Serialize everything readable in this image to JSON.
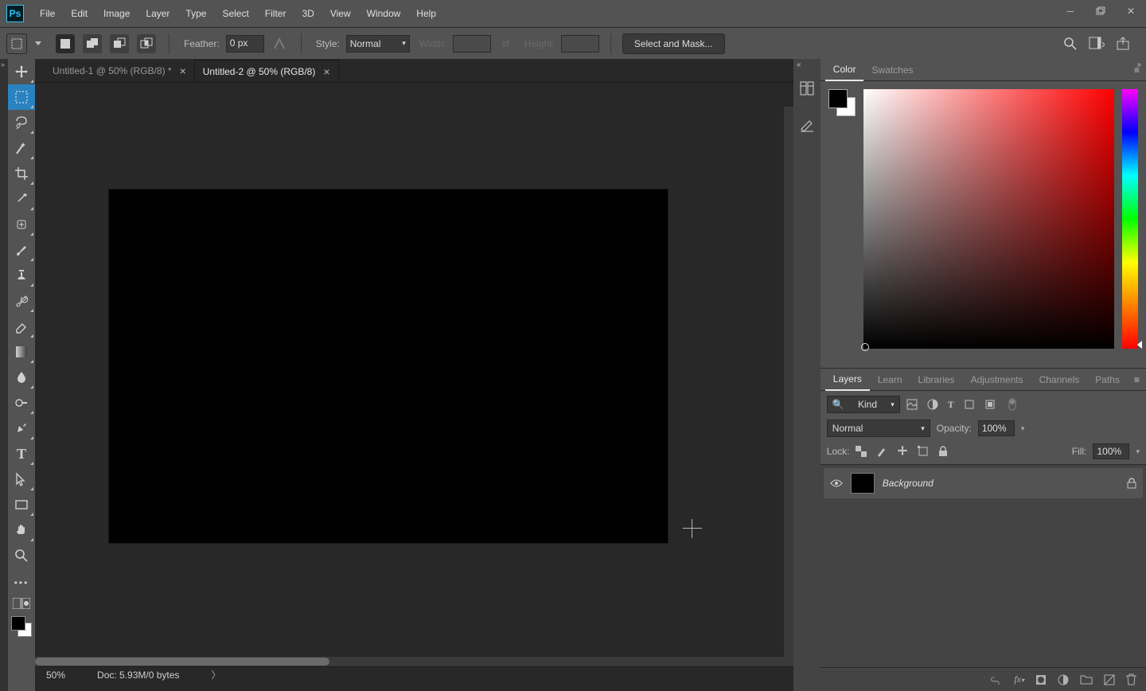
{
  "menu": {
    "items": [
      "File",
      "Edit",
      "Image",
      "Layer",
      "Type",
      "Select",
      "Filter",
      "3D",
      "View",
      "Window",
      "Help"
    ]
  },
  "options": {
    "feather_label": "Feather:",
    "feather_value": "0 px",
    "style_label": "Style:",
    "style_value": "Normal",
    "width_label": "Width:",
    "height_label": "Height:",
    "select_mask": "Select and Mask..."
  },
  "tabs": [
    {
      "title": "Untitled-1 @ 50% (RGB/8) *",
      "active": false
    },
    {
      "title": "Untitled-2 @ 50% (RGB/8)",
      "active": true
    }
  ],
  "status": {
    "zoom": "50%",
    "doc": "Doc: 5.93M/0 bytes"
  },
  "panelTabs": {
    "color": [
      "Color",
      "Swatches"
    ],
    "layers": [
      "Layers",
      "Learn",
      "Libraries",
      "Adjustments",
      "Channels",
      "Paths"
    ]
  },
  "layers": {
    "filter_kind": "Kind",
    "blend_mode": "Normal",
    "opacity_label": "Opacity:",
    "opacity_value": "100%",
    "lock_label": "Lock:",
    "fill_label": "Fill:",
    "fill_value": "100%",
    "items": [
      {
        "name": "Background"
      }
    ]
  }
}
